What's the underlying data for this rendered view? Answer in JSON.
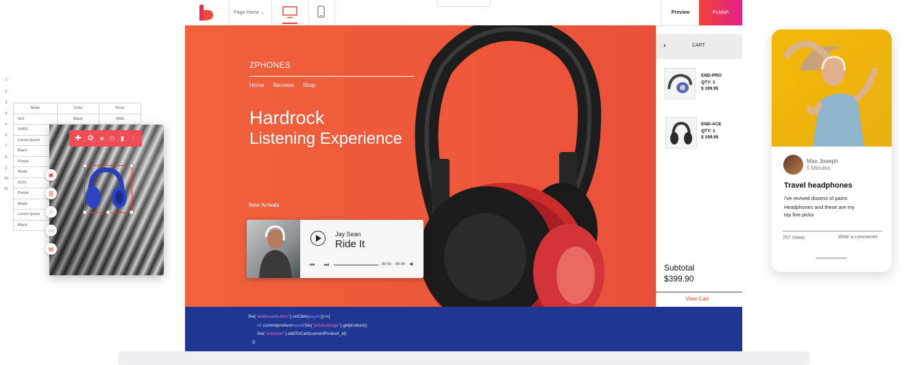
{
  "spreadsheet": {
    "row_numbers": [
      "1",
      "2",
      "3",
      "4",
      "5",
      "6",
      "7",
      "8",
      "9",
      "10",
      "11"
    ],
    "headers": [
      "Mode",
      "Color",
      "Price"
    ],
    "rows": [
      [
        "S#1",
        "Black",
        "#000"
      ],
      [
        "S#f00",
        "",
        ""
      ],
      [
        "Lorem Ipsum",
        "",
        ""
      ],
      [
        "Black",
        "",
        ""
      ],
      [
        "Purple",
        "",
        ""
      ],
      [
        "Mode",
        "",
        ""
      ],
      [
        "#123",
        "",
        ""
      ],
      [
        "Purple",
        "",
        ""
      ],
      [
        "Mode",
        "",
        ""
      ],
      [
        "Lorem Ipsum",
        "",
        ""
      ],
      [
        "Black",
        "",
        ""
      ]
    ]
  },
  "editor_toolbar": {
    "icons": [
      "plus-icon",
      "gear-icon",
      "link-icon",
      "power-icon",
      "trash-icon",
      "more-icon"
    ],
    "side_icons": [
      "image-icon",
      "barcode-icon",
      "star-icon",
      "comment-icon",
      "save-icon"
    ]
  },
  "topbar": {
    "page_select": "Page Home",
    "preview_label": "Preview",
    "publish_label": "Publish"
  },
  "hero": {
    "brand": "ZPHONES",
    "nav": [
      "Home",
      "Reviews",
      "Shop"
    ],
    "headline_1": "Hardrock",
    "headline_2": "Listening Experience",
    "new_arrivals": "New Arrivals",
    "player": {
      "artist": "Jay Sean",
      "track": "Ride It",
      "time_current": "00:00",
      "time_total": "00:04"
    }
  },
  "cart": {
    "title": "CART",
    "items": [
      {
        "name": "END-PRO",
        "qty": "QTY: 1",
        "price": "$ 199.95"
      },
      {
        "name": "END-ACE",
        "qty": "QTY: 1",
        "price": "$ 199.95"
      }
    ],
    "subtotal_label": "Subtotal",
    "subtotal_value": "$399.90",
    "view_cart": "View Cart"
  },
  "code": {
    "line1_a": "Sw(",
    "line1_b": "\"addtocartbutton\"",
    "line1_c": ").onClick(",
    "line1_d": "async",
    "line1_e": "()=>{",
    "line2_a": "let",
    "line2_b": " currentproduct=",
    "line2_c": "await",
    "line2_d": "Sw(",
    "line2_e": "\"productpage\"",
    "line2_f": ").getproduct()",
    "line3_a": "Sw(",
    "line3_b": "\"storecart\"",
    "line3_c": ").addToCart(currentProduct_id)",
    "line4": "})"
  },
  "mobile_card": {
    "author": "Max Joseph",
    "read_time": "5 Minutes",
    "title": "Travel headphones",
    "line1": "I've revived dozens of pains",
    "line2": "Headphones and these are my",
    "line3": "top five picks",
    "views": "257 Views",
    "comment_link": "Write a commenet"
  },
  "colors": {
    "hero_orange": "#f0613b",
    "publish_gradient_start": "#ef4237",
    "publish_gradient_end": "#e2218a",
    "code_bg": "#1f3791",
    "phone_image_yellow": "#f2b806",
    "accent_red": "#ee4a3a"
  }
}
